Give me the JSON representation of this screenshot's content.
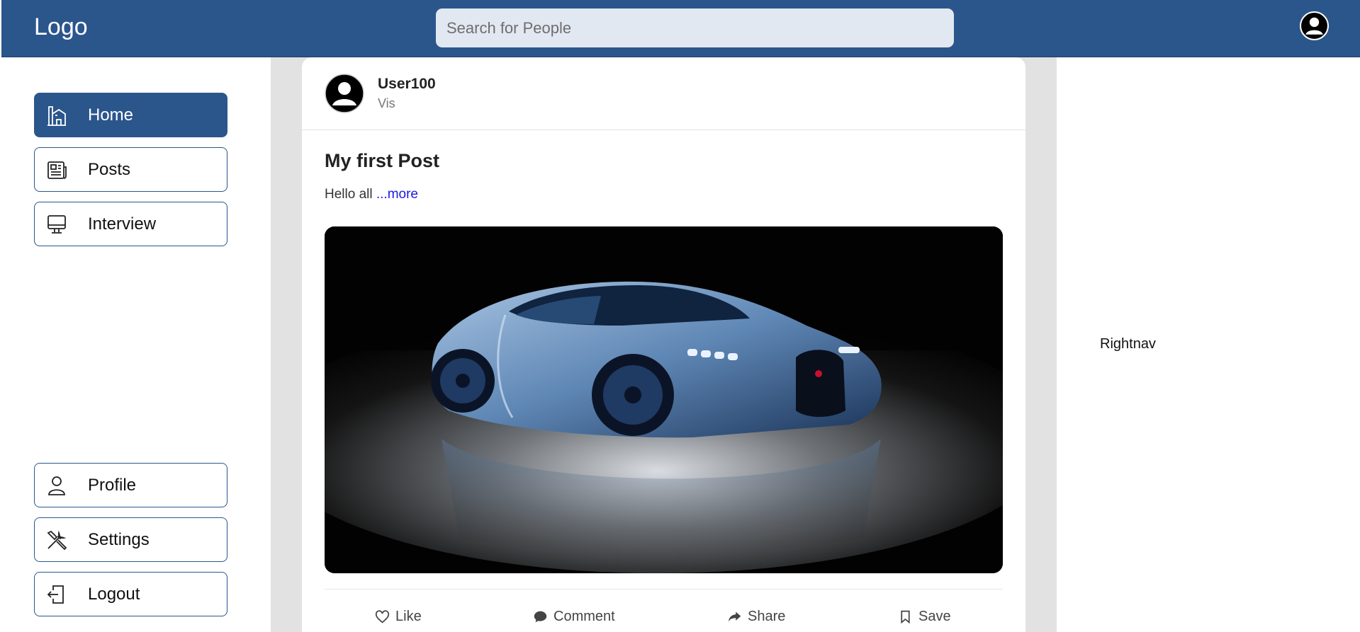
{
  "header": {
    "logo": "Logo",
    "search_placeholder": "Search for People",
    "avatar_icon": "user-circle-icon"
  },
  "sidebar": {
    "top_items": [
      {
        "label": "Home",
        "icon": "home-icon",
        "active": true
      },
      {
        "label": "Posts",
        "icon": "newspaper-icon",
        "active": false
      },
      {
        "label": "Interview",
        "icon": "monitor-icon",
        "active": false
      }
    ],
    "bottom_items": [
      {
        "label": "Profile",
        "icon": "user-icon"
      },
      {
        "label": "Settings",
        "icon": "tools-icon"
      },
      {
        "label": "Logout",
        "icon": "logout-icon"
      }
    ]
  },
  "post": {
    "username": "User100",
    "visibility": "Vis",
    "title": "My first Post",
    "body": "Hello all",
    "more_link": "...more",
    "image_alt": "sports-car-photo",
    "actions": {
      "like": "Like",
      "comment": "Comment",
      "share": "Share",
      "save": "Save"
    }
  },
  "rightnav": {
    "label": "Rightnav"
  },
  "colors": {
    "primary": "#2b568c",
    "search_bg": "#e2e8f1",
    "feed_bg": "#e2e2e2",
    "link": "#1a1ae6"
  }
}
